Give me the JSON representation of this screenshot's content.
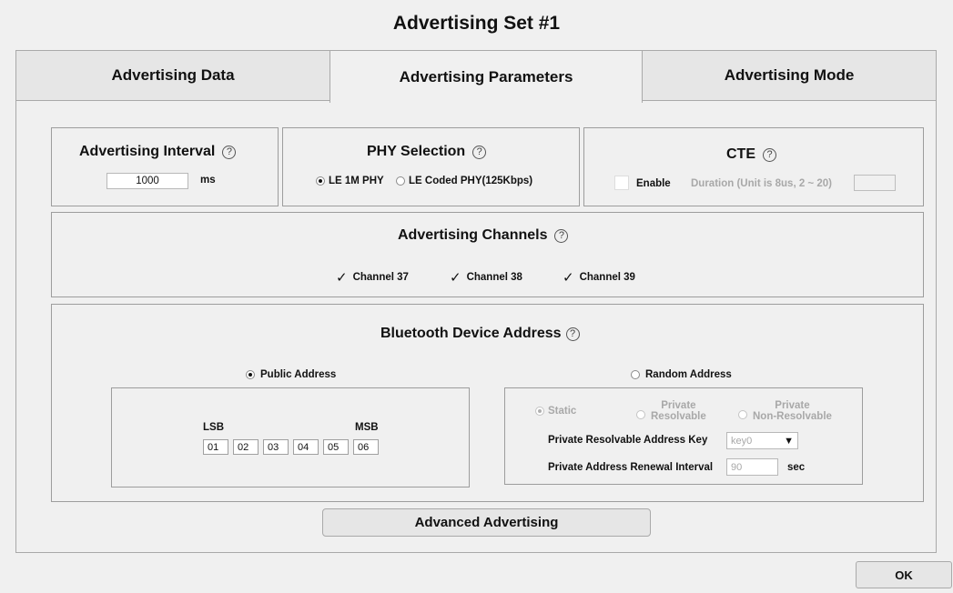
{
  "window": {
    "title": "Advertising Set #1"
  },
  "tabs": [
    {
      "label": "Advertising Data"
    },
    {
      "label": "Advertising Parameters"
    },
    {
      "label": "Advertising Mode"
    }
  ],
  "interval": {
    "title": "Advertising Interval",
    "help": "?",
    "value": "1000",
    "unit": "ms"
  },
  "phy": {
    "title": "PHY Selection",
    "help": "?",
    "option1": "LE 1M PHY",
    "option2": "LE Coded PHY(125Kbps)",
    "selected": "LE 1M PHY"
  },
  "cte": {
    "title": "CTE",
    "help": "?",
    "enable_label": "Enable",
    "duration_label": "Duration (Unit is 8us, 2 ~ 20)",
    "duration_value": ""
  },
  "channels": {
    "title": "Advertising Channels",
    "help": "?",
    "items": [
      {
        "label": "Channel 37",
        "checked": true
      },
      {
        "label": "Channel 38",
        "checked": true
      },
      {
        "label": "Channel 39",
        "checked": true
      }
    ],
    "check_glyph": "✓"
  },
  "address": {
    "title": "Bluetooth Device Address",
    "help": "?",
    "public_label": "Public Address",
    "random_label": "Random Address",
    "selected": "Public Address",
    "lsb": "LSB",
    "msb": "MSB",
    "bytes": [
      "01",
      "02",
      "03",
      "04",
      "05",
      "06"
    ],
    "static_label": "Static",
    "private_resolvable_1": "Private",
    "private_resolvable_2": "Resolvable",
    "private_nonres_1": "Private",
    "private_nonres_2": "Non-Resolvable",
    "key_label": "Private Resolvable Address Key",
    "key_value": "key0",
    "renewal_label": "Private Address Renewal Interval",
    "renewal_value": "90",
    "renewal_unit": "sec"
  },
  "buttons": {
    "advanced": "Advanced Advertising",
    "ok": "OK"
  },
  "icons": {
    "dropdown": "▼"
  }
}
